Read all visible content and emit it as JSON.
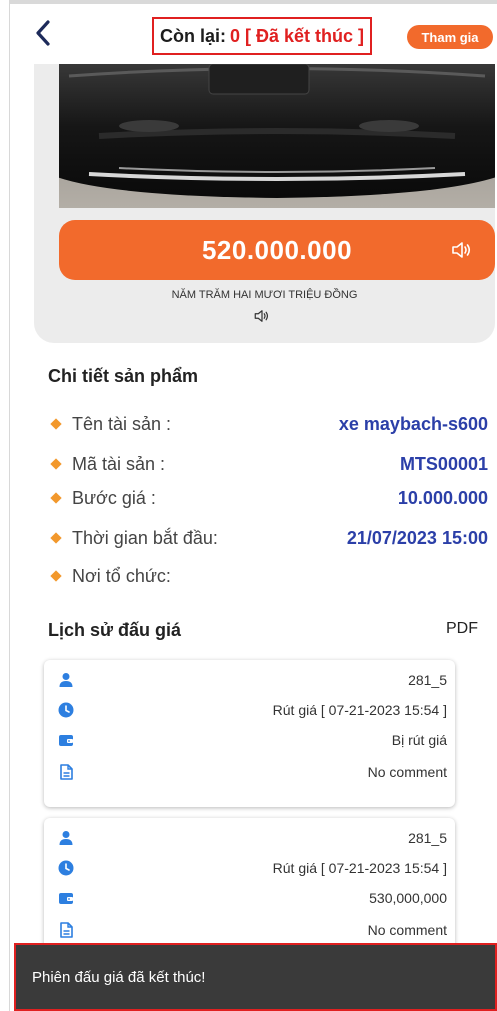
{
  "header": {
    "status_label": "Còn lại:",
    "status_value": "0 [ Đã kết thúc ]",
    "join_label": "Tham gia"
  },
  "auction": {
    "price": "520.000.000",
    "price_words": "NĂM TRĂM HAI MƯƠI TRIỆU ĐỒNG"
  },
  "details": {
    "title": "Chi tiết sản phẩm",
    "rows": [
      {
        "label": "Tên tài sản :",
        "value": "xe maybach-s600"
      },
      {
        "label": "Mã tài sản :",
        "value": "MTS00001"
      },
      {
        "label": "Bước giá :",
        "value": "10.000.000"
      },
      {
        "label": "Thời gian bắt đầu:",
        "value": "21/07/2023 15:00"
      },
      {
        "label": "Nơi tổ chức:",
        "value": ""
      }
    ]
  },
  "history": {
    "title": "Lịch sử đấu giá",
    "pdf_label": "PDF",
    "entries": [
      {
        "user": "281_5",
        "action": "Rút giá [ 07-21-2023 15:54 ]",
        "amount": "Bị rút giá",
        "comment": "No comment"
      },
      {
        "user": "281_5",
        "action": "Rút giá [ 07-21-2023 15:54 ]",
        "amount": "530,000,000",
        "comment": "No comment"
      }
    ]
  },
  "toast": {
    "message": "Phiên đấu giá đã kết thúc!"
  },
  "colors": {
    "accent": "#f26a2c",
    "status_red": "#e02020",
    "value_blue": "#2b3fa8",
    "icon_blue": "#2d7fe0",
    "bullet_orange": "#f2982c"
  }
}
